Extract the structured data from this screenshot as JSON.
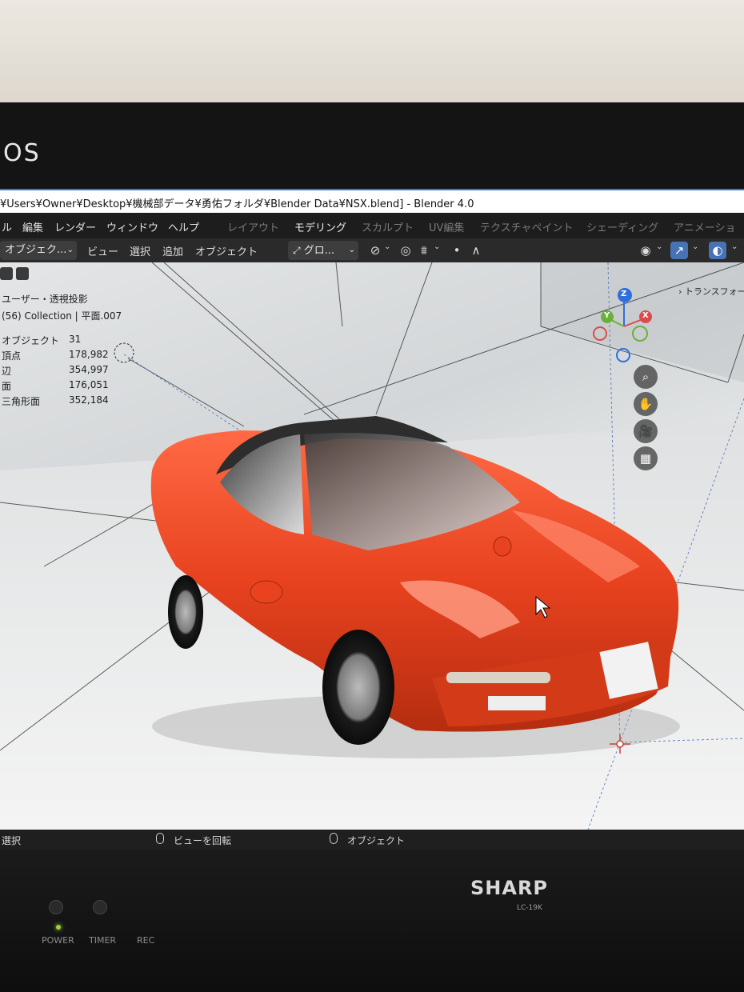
{
  "monitor": {
    "top_brand": "OS",
    "brand": "SHARP",
    "model": "LC-19K",
    "hw_labels": {
      "power": "POWER",
      "timer": "TIMER",
      "rec": "REC"
    }
  },
  "window": {
    "title": "¥Users¥Owner¥Desktop¥機械部データ¥勇佑フォルダ¥Blender Data¥NSX.blend] - Blender 4.0"
  },
  "menubar": {
    "items": [
      "ル",
      "編集",
      "レンダー",
      "ウィンドウ",
      "ヘルプ"
    ],
    "workspaces": [
      "レイアウト",
      "モデリング",
      "スカルプト",
      "UV編集",
      "テクスチャペイント",
      "シェーディング",
      "アニメーショ"
    ],
    "active_workspace": "モデリング"
  },
  "toolbar": {
    "mode": "オブジェク...",
    "menus": [
      "ビュー",
      "選択",
      "追加",
      "オブジェクト"
    ],
    "transform_orientation": "グロ...",
    "icons": [
      "transform-pivot-icon",
      "snap-icon",
      "proportional-edit-icon",
      "falloff-icon",
      "visibility-icon",
      "gizmo-icon",
      "overlay-icon"
    ]
  },
  "viewport": {
    "view_name": "ユーザー・透視投影",
    "collection": "(56) Collection | 平面.007",
    "stats": [
      {
        "label": "オブジェクト",
        "value": "31"
      },
      {
        "label": "頂点",
        "value": "178,982"
      },
      {
        "label": "辺",
        "value": "354,997"
      },
      {
        "label": "面",
        "value": "176,051"
      },
      {
        "label": "三角形面",
        "value": "352,184"
      }
    ],
    "sidebar_tab": "トランスフォーム",
    "gizmo": {
      "z": "Z",
      "y": "Y",
      "x": "X"
    },
    "car_color": "#e8421f"
  },
  "statusbar": {
    "left": "選択",
    "middle": "ビューを回転",
    "right": "オブジェクト"
  }
}
